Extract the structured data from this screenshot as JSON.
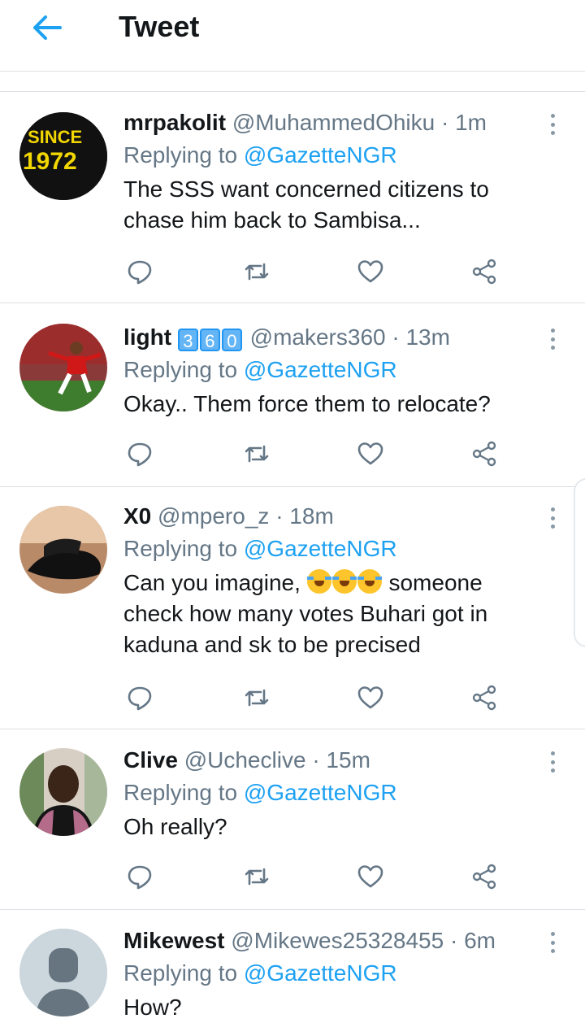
{
  "header": {
    "title": "Tweet"
  },
  "tweets": [
    {
      "name": "mrpakolit",
      "handle": "@MuhammedOhiku",
      "time": "1m",
      "replying_prefix": "Replying to",
      "replying_to": "@GazetteNGR",
      "body_lines": [
        "The SSS want concerned  citizens to",
        "chase him back to Sambisa..."
      ],
      "avatar_text_1": "SINCE",
      "avatar_text_2": "1972"
    },
    {
      "name": "light",
      "name_keycaps": [
        "3",
        "6",
        "0"
      ],
      "handle": "@makers360",
      "time": "13m",
      "replying_prefix": "Replying to",
      "replying_to": "@GazetteNGR",
      "body_lines": [
        "Okay.. Them force them to relocate?"
      ]
    },
    {
      "name": "X0",
      "handle": "@mpero_z",
      "time": "18m",
      "replying_prefix": "Replying to",
      "replying_to": "@GazetteNGR",
      "body_line1_before": "Can you imagine,",
      "body_line1_after": "someone",
      "body_lines": [
        "check how many votes Buhari got in",
        "kaduna and sk to be precised"
      ]
    },
    {
      "name": "Clive",
      "handle": "@Ucheclive",
      "time": "15m",
      "replying_prefix": "Replying to",
      "replying_to": "@GazetteNGR",
      "body_lines": [
        "Oh really?"
      ]
    },
    {
      "name": "Mikewest",
      "handle": "@Mikewes25328455",
      "time": "6m",
      "replying_prefix": "Replying to",
      "replying_to": "@GazetteNGR",
      "body_lines": [
        "How?"
      ]
    }
  ],
  "icons": {
    "back": "arrow-left-icon",
    "reply": "reply-bubble-icon",
    "retweet": "retweet-icon",
    "like": "heart-icon",
    "share": "share-icon",
    "more": "more-vertical-icon"
  },
  "colors": {
    "accent": "#1da1f2",
    "text": "#14171a",
    "muted": "#657786",
    "divider": "#dcdfe3"
  }
}
